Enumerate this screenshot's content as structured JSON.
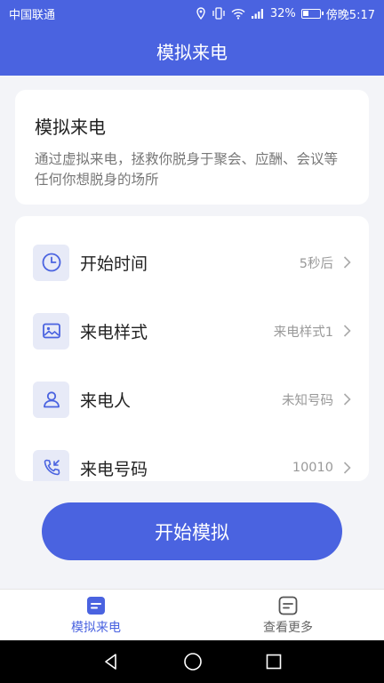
{
  "status_bar": {
    "carrier": "中国联通",
    "battery": "32%",
    "time": "傍晚5:17"
  },
  "header": {
    "title": "模拟来电"
  },
  "info_card": {
    "title": "模拟来电",
    "description": "通过虚拟来电，拯救你脱身于聚会、应酬、会议等任何你想脱身的场所"
  },
  "settings": [
    {
      "label": "开始时间",
      "value": "5秒后",
      "icon": "clock-icon"
    },
    {
      "label": "来电样式",
      "value": "来电样式1",
      "icon": "image-icon"
    },
    {
      "label": "来电人",
      "value": "未知号码",
      "icon": "person-icon"
    },
    {
      "label": "来电号码",
      "value": "10010",
      "icon": "incoming-call-icon"
    }
  ],
  "start_button": {
    "label": "开始模拟"
  },
  "tabs": [
    {
      "label": "模拟来电",
      "active": true
    },
    {
      "label": "查看更多",
      "active": false
    }
  ],
  "colors": {
    "primary": "#4a63e0",
    "icon_bg": "#e7eaf7",
    "background": "#f3f4f8"
  }
}
